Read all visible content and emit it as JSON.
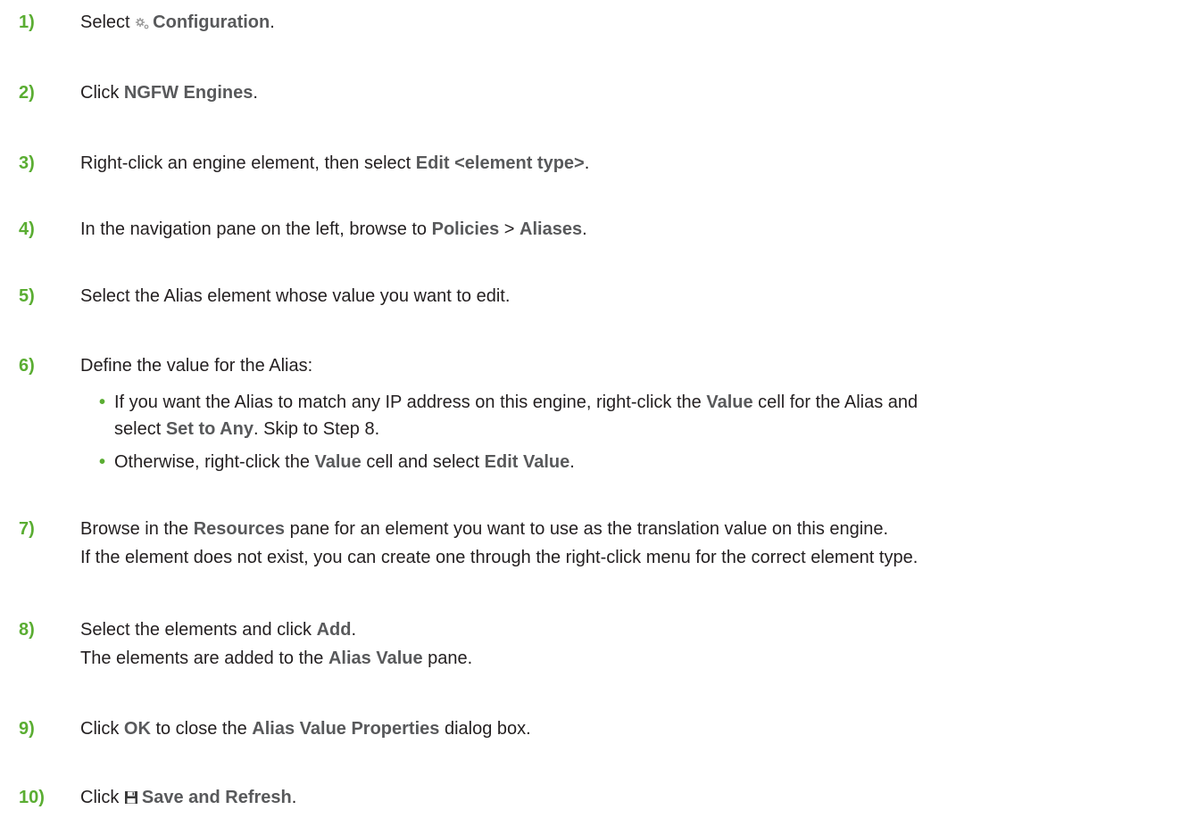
{
  "steps": [
    {
      "num": "1)",
      "pre": "Select ",
      "b1": "Configuration",
      "post": "."
    },
    {
      "num": "2)",
      "pre": "Click ",
      "b1": "NGFW Engines",
      "post": "."
    },
    {
      "num": "3)",
      "pre": "Right-click an engine element, then select ",
      "b1": "Edit <element type>",
      "post": "."
    },
    {
      "num": "4)",
      "pre": "In the navigation pane on the left, browse to ",
      "b1": "Policies",
      "mid": " > ",
      "b2": "Aliases",
      "post": "."
    },
    {
      "num": "5)",
      "text": "Select the Alias element whose value you want to edit."
    },
    {
      "num": "6)",
      "text": "Define the value for the Alias:",
      "bullet1": {
        "pre": "If you want the Alias to match any IP address on this engine, right-click the ",
        "b1": "Value",
        "post": " cell for the Alias and",
        "l2pre": "select ",
        "l2b": "Set to Any",
        "l2post": ". Skip to Step 8."
      },
      "bullet2": {
        "pre": "Otherwise, right-click the ",
        "b1": "Value",
        "mid": " cell and select ",
        "b2": "Edit Value",
        "post": "."
      }
    },
    {
      "num": "7)",
      "pre": "Browse in the ",
      "b1": "Resources",
      "post": " pane for an element you want to use as the translation value on this engine.",
      "line2": "If the element does not exist, you can create one through the right-click menu for the correct element type."
    },
    {
      "num": "8)",
      "pre": "Select the elements and click ",
      "b1": "Add",
      "post": ".",
      "l2pre": "The elements are added to the ",
      "l2b": "Alias Value",
      "l2post": " pane."
    },
    {
      "num": "9)",
      "pre": "Click ",
      "b1": "OK",
      "mid": " to close the ",
      "b2": "Alias Value Properties",
      "post": " dialog box."
    },
    {
      "num": "10)",
      "pre": "Click ",
      "b1": "Save and Refresh",
      "post": "."
    }
  ],
  "bullet_char": "•",
  "colors": {
    "accent": "#5aad32",
    "bold_text": "#58595b",
    "body_text": "#231f20"
  },
  "icons": {
    "step1": "gear-icon",
    "step10": "save-icon"
  }
}
